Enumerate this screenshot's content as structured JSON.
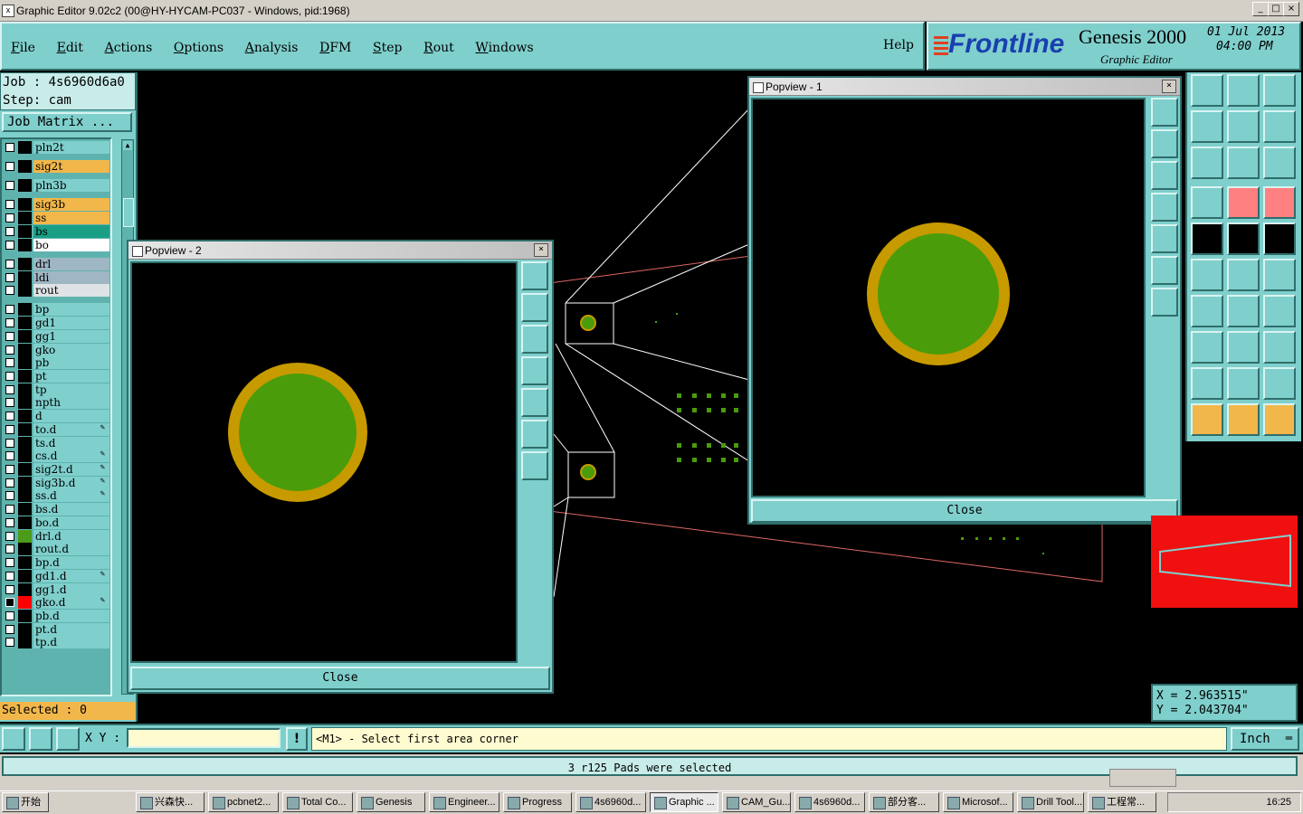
{
  "window": {
    "title": "Graphic Editor 9.02c2 (00@HY-HYCAM-PC037 - Windows, pid:1968)"
  },
  "menu": {
    "items": [
      "File",
      "Edit",
      "Actions",
      "Options",
      "Analysis",
      "DFM",
      "Step",
      "Rout",
      "Windows"
    ],
    "help": "Help"
  },
  "brand": {
    "logo": "Frontline",
    "product": "Genesis 2000",
    "subtitle": "Graphic Editor",
    "date": "01 Jul 2013",
    "time": "04:00 PM"
  },
  "job": {
    "job_label": "Job : 4s6960d6a0",
    "step_label": "Step: cam",
    "matrix_button": "Job Matrix ..."
  },
  "layers": [
    {
      "name": "pln2t",
      "color": "#7fcfcc",
      "swatch": "#000"
    },
    {
      "name": "sig2t",
      "color": "#f2b74a",
      "swatch": "#000"
    },
    {
      "name": "pln3b",
      "color": "#7fcfcc",
      "swatch": "#000"
    },
    {
      "name": "sig3b",
      "color": "#f2b74a",
      "swatch": "#000"
    },
    {
      "name": "ss",
      "color": "#f2b74a",
      "swatch": "#000"
    },
    {
      "name": "bs",
      "color": "#1a9f86",
      "swatch": "#000"
    },
    {
      "name": "bo",
      "color": "#ffffff",
      "swatch": "#000"
    },
    {
      "name": "drl",
      "color": "#9fb6c4",
      "swatch": "#000"
    },
    {
      "name": "ldi",
      "color": "#9fb6c4",
      "swatch": "#000"
    },
    {
      "name": "rout",
      "color": "#dfe3e6",
      "swatch": "#000"
    },
    {
      "name": "bp",
      "color": "#7fcfcc",
      "swatch": "#000"
    },
    {
      "name": "gd1",
      "color": "#7fcfcc",
      "swatch": "#000"
    },
    {
      "name": "gg1",
      "color": "#7fcfcc",
      "swatch": "#000"
    },
    {
      "name": "gko",
      "color": "#7fcfcc",
      "swatch": "#000"
    },
    {
      "name": "pb",
      "color": "#7fcfcc",
      "swatch": "#000"
    },
    {
      "name": "pt",
      "color": "#7fcfcc",
      "swatch": "#000"
    },
    {
      "name": "tp",
      "color": "#7fcfcc",
      "swatch": "#000"
    },
    {
      "name": "npth",
      "color": "#7fcfcc",
      "swatch": "#000"
    },
    {
      "name": "d",
      "color": "#7fcfcc",
      "swatch": "#000"
    },
    {
      "name": "to.d",
      "color": "#7fcfcc",
      "swatch": "#000",
      "edit": true
    },
    {
      "name": "ts.d",
      "color": "#7fcfcc",
      "swatch": "#000"
    },
    {
      "name": "cs.d",
      "color": "#7fcfcc",
      "swatch": "#000",
      "edit": true
    },
    {
      "name": "sig2t.d",
      "color": "#7fcfcc",
      "swatch": "#000",
      "edit": true
    },
    {
      "name": "sig3b.d",
      "color": "#7fcfcc",
      "swatch": "#000",
      "edit": true
    },
    {
      "name": "ss.d",
      "color": "#7fcfcc",
      "swatch": "#000",
      "edit": true
    },
    {
      "name": "bs.d",
      "color": "#7fcfcc",
      "swatch": "#000"
    },
    {
      "name": "bo.d",
      "color": "#7fcfcc",
      "swatch": "#000"
    },
    {
      "name": "drl.d",
      "color": "#7fcfcc",
      "swatch": "#4a9c1a"
    },
    {
      "name": "rout.d",
      "color": "#7fcfcc",
      "swatch": "#000"
    },
    {
      "name": "bp.d",
      "color": "#7fcfcc",
      "swatch": "#000"
    },
    {
      "name": "gd1.d",
      "color": "#7fcfcc",
      "swatch": "#000",
      "edit": true
    },
    {
      "name": "gg1.d",
      "color": "#7fcfcc",
      "swatch": "#000"
    },
    {
      "name": "gko.d",
      "color": "#7fcfcc",
      "swatch": "#ff0000",
      "edit": true,
      "active": true
    },
    {
      "name": "pb.d",
      "color": "#7fcfcc",
      "swatch": "#000"
    },
    {
      "name": "pt.d",
      "color": "#7fcfcc",
      "swatch": "#000"
    },
    {
      "name": "tp.d",
      "color": "#7fcfcc",
      "swatch": "#000"
    }
  ],
  "selected": "Selected : 0",
  "popview1": {
    "title": "Popview - 1",
    "close": "Close"
  },
  "popview2": {
    "title": "Popview - 2",
    "close": "Close"
  },
  "coords": {
    "x": "X = 2.963515\"",
    "y": "Y = 2.043704\""
  },
  "command": {
    "xy_label": "X Y :",
    "xy_value": "",
    "prompt": "<M1> - Select first area corner",
    "units": "Inch"
  },
  "status": "3 r125 Pads were selected",
  "taskbar": {
    "start": "开始",
    "tasks": [
      "兴森快...",
      "pcbnet2...",
      "Total Co...",
      "Genesis",
      "Engineer...",
      "Progress",
      "4s6960d...",
      "Graphic ...",
      "CAM_Gu...",
      "4s6960d...",
      "部分客...",
      "Microsof...",
      "Drill Tool...",
      "工程常..."
    ],
    "clock": "16:25"
  },
  "colors": {
    "panel": "#7fcfcc",
    "pad_ring": "#c79a00",
    "pad_fill": "#4a9c0a",
    "selected_yellow": "#f2b74a"
  }
}
